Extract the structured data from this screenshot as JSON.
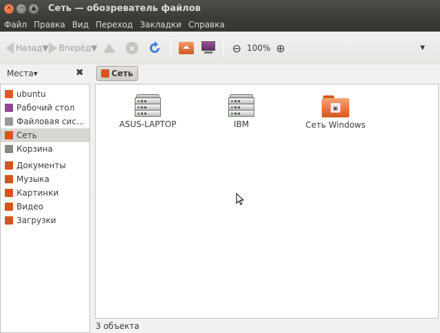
{
  "window": {
    "title": "Сеть — обозреватель файлов",
    "buttons": {
      "close": "×",
      "minimize": "−",
      "maximize": "▲"
    }
  },
  "menu": [
    "Файл",
    "Правка",
    "Вид",
    "Переход",
    "Закладки",
    "Справка"
  ],
  "toolbar": {
    "back_label": "Назад",
    "forward_label": "Вперёд",
    "stop_glyph": "×",
    "zoom_out_glyph": "⊖",
    "zoom_in_glyph": "⊕",
    "zoom_level": "100%",
    "menu_glyph": "▼",
    "dropdown_glyph": "▼"
  },
  "sidebar": {
    "header_label": "Места",
    "header_dropdown": "▾",
    "close_glyph": "✖",
    "items": [
      {
        "label": "ubuntu",
        "icon": "home-folder-icon",
        "color": "#e05b24"
      },
      {
        "label": "Рабочий стол",
        "icon": "desktop-icon",
        "color": "#8e4a90"
      },
      {
        "label": "Файловая сис...",
        "icon": "drive-icon",
        "color": "#9a9893"
      },
      {
        "label": "Сеть",
        "icon": "network-icon",
        "color": "#d5541f"
      },
      {
        "label": "Корзина",
        "icon": "trash-icon",
        "color": "#8a8883"
      },
      {
        "label": "Документы",
        "icon": "documents-folder-icon",
        "color": "#d5541f"
      },
      {
        "label": "Музыка",
        "icon": "music-folder-icon",
        "color": "#d5541f"
      },
      {
        "label": "Картинки",
        "icon": "pictures-folder-icon",
        "color": "#d5541f"
      },
      {
        "label": "Видео",
        "icon": "videos-folder-icon",
        "color": "#d5541f"
      },
      {
        "label": "Загрузки",
        "icon": "downloads-folder-icon",
        "color": "#d5541f"
      }
    ],
    "active_index": 3
  },
  "pathbar": {
    "label": "Сеть"
  },
  "files": [
    {
      "label": "ASUS-LAPTOP",
      "icon": "server-icon"
    },
    {
      "label": "IBM",
      "icon": "server-icon"
    },
    {
      "label": "Сеть Windows",
      "icon": "windows-network-folder-icon"
    }
  ],
  "status": {
    "text": "3 объекта"
  },
  "colors": {
    "accent": "#e05b24",
    "titlebar": "#3c3b37",
    "selection": "#d8d6d3"
  }
}
